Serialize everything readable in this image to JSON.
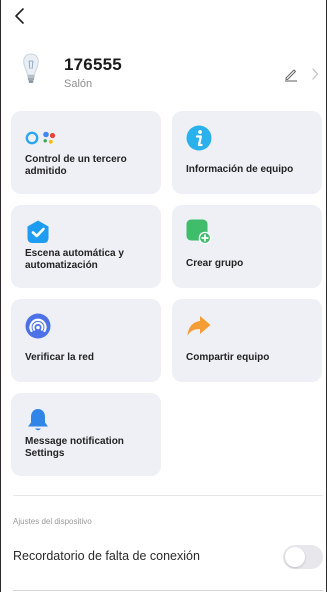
{
  "device": {
    "name": "176555",
    "room": "Salón"
  },
  "grid": {
    "items": [
      {
        "label": "Control de un tercero admitido",
        "icon": "voice-assistant-icon"
      },
      {
        "label": "Información de equipo",
        "icon": "info-icon"
      },
      {
        "label": "Escena automática y automatización",
        "icon": "automation-check-icon"
      },
      {
        "label": "Crear grupo",
        "icon": "create-group-icon"
      },
      {
        "label": "Verificar la red",
        "icon": "network-check-icon"
      },
      {
        "label": "Compartir equipo",
        "icon": "share-icon"
      },
      {
        "label": "Message notification Settings",
        "icon": "bell-icon"
      }
    ]
  },
  "settings": {
    "section_title": "Ajustes del dispositivo",
    "offline_reminder": {
      "label": "Recordatorio de falta de conexión",
      "enabled": false
    }
  },
  "colors": {
    "card_background": "#eef0f6",
    "info_blue": "#2ab0ea",
    "automation_blue": "#1d9df2",
    "group_green": "#3fbd6a",
    "network_purple": "#4d72e8",
    "share_orange": "#f59d34",
    "bell_blue": "#2f86e8"
  }
}
